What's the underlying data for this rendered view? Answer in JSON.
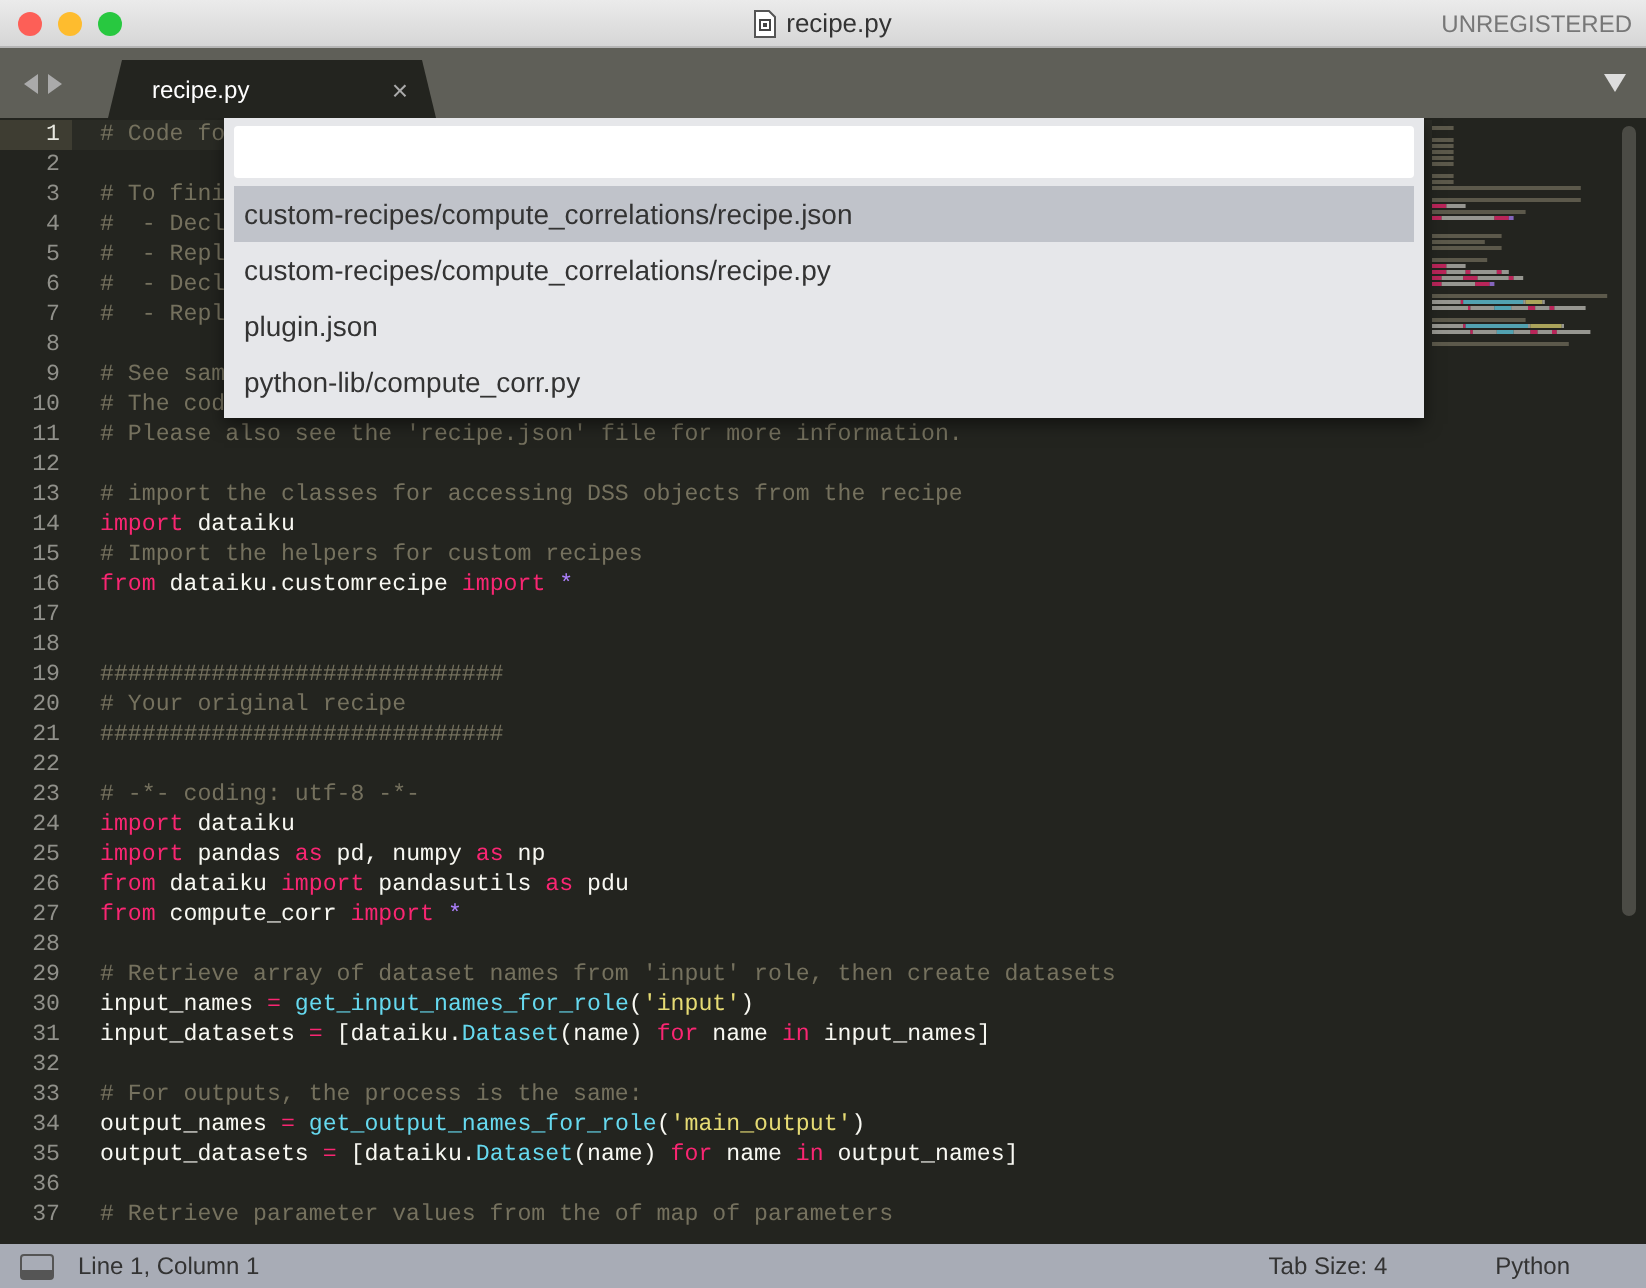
{
  "window": {
    "title": "recipe.py",
    "badge": "UNREGISTERED"
  },
  "tabs": [
    {
      "label": "recipe.py",
      "close": "×",
      "selected": true
    }
  ],
  "editor": {
    "lines": [
      {
        "number": "1",
        "current": true,
        "tokens": [
          {
            "kind": "comment",
            "text": "# Code fo"
          }
        ]
      },
      {
        "number": "2",
        "current": false
      },
      {
        "number": "3",
        "current": false,
        "tokens": [
          {
            "kind": "comment",
            "text": "# To fini"
          }
        ]
      },
      {
        "number": "4",
        "current": false,
        "tokens": [
          {
            "kind": "comment",
            "text": "#  - Decl"
          }
        ]
      },
      {
        "number": "5",
        "current": false,
        "tokens": [
          {
            "kind": "comment",
            "text": "#  - Repl"
          }
        ]
      },
      {
        "number": "6",
        "current": false,
        "tokens": [
          {
            "kind": "comment",
            "text": "#  - Decl"
          }
        ]
      },
      {
        "number": "7",
        "current": false,
        "tokens": [
          {
            "kind": "comment",
            "text": "#  - Repl"
          }
        ]
      },
      {
        "number": "8",
        "current": false
      },
      {
        "number": "9",
        "current": false,
        "tokens": [
          {
            "kind": "comment",
            "text": "# See sam"
          }
        ]
      },
      {
        "number": "10",
        "current": false,
        "tokens": [
          {
            "kind": "comment",
            "text": "# The cod"
          }
        ]
      },
      {
        "number": "11",
        "current": false,
        "tokens": [
          {
            "kind": "comment",
            "text": "# Please also see the 'recipe.json' file for more information."
          }
        ]
      },
      {
        "number": "12",
        "current": false
      },
      {
        "number": "13",
        "current": false,
        "tokens": [
          {
            "kind": "comment",
            "text": "# import the classes for accessing DSS objects from the recipe"
          }
        ]
      },
      {
        "number": "14",
        "current": false,
        "tokens": [
          {
            "kind": "keyword",
            "text": "import"
          },
          {
            "kind": "plain",
            "text": " dataiku"
          }
        ]
      },
      {
        "number": "15",
        "current": false,
        "tokens": [
          {
            "kind": "comment",
            "text": "# Import the helpers for custom recipes"
          }
        ]
      },
      {
        "number": "16",
        "current": false,
        "tokens": [
          {
            "kind": "keyword",
            "text": "from"
          },
          {
            "kind": "plain",
            "text": " dataiku.customrecipe "
          },
          {
            "kind": "keyword",
            "text": "import"
          },
          {
            "kind": "constant",
            "text": " *"
          }
        ]
      },
      {
        "number": "17",
        "current": false
      },
      {
        "number": "18",
        "current": false
      },
      {
        "number": "19",
        "current": false,
        "tokens": [
          {
            "kind": "comment",
            "text": "#############################"
          }
        ]
      },
      {
        "number": "20",
        "current": false,
        "tokens": [
          {
            "kind": "comment",
            "text": "# Your original recipe"
          }
        ]
      },
      {
        "number": "21",
        "current": false,
        "tokens": [
          {
            "kind": "comment",
            "text": "#############################"
          }
        ]
      },
      {
        "number": "22",
        "current": false
      },
      {
        "number": "23",
        "current": false,
        "tokens": [
          {
            "kind": "comment",
            "text": "# -*- coding: utf-8 -*-"
          }
        ]
      },
      {
        "number": "24",
        "current": false,
        "tokens": [
          {
            "kind": "keyword",
            "text": "import"
          },
          {
            "kind": "plain",
            "text": " dataiku"
          }
        ]
      },
      {
        "number": "25",
        "current": false,
        "tokens": [
          {
            "kind": "keyword",
            "text": "import"
          },
          {
            "kind": "plain",
            "text": " pandas "
          },
          {
            "kind": "keyword",
            "text": "as"
          },
          {
            "kind": "plain",
            "text": " pd, numpy "
          },
          {
            "kind": "keyword",
            "text": "as"
          },
          {
            "kind": "plain",
            "text": " np"
          }
        ]
      },
      {
        "number": "26",
        "current": false,
        "tokens": [
          {
            "kind": "keyword",
            "text": "from"
          },
          {
            "kind": "plain",
            "text": " dataiku "
          },
          {
            "kind": "keyword",
            "text": "import"
          },
          {
            "kind": "plain",
            "text": " pandasutils "
          },
          {
            "kind": "keyword",
            "text": "as"
          },
          {
            "kind": "plain",
            "text": " pdu"
          }
        ]
      },
      {
        "number": "27",
        "current": false,
        "tokens": [
          {
            "kind": "keyword",
            "text": "from"
          },
          {
            "kind": "plain",
            "text": " compute_corr "
          },
          {
            "kind": "keyword",
            "text": "import"
          },
          {
            "kind": "constant",
            "text": " *"
          }
        ]
      },
      {
        "number": "28",
        "current": false
      },
      {
        "number": "29",
        "current": false,
        "tokens": [
          {
            "kind": "comment",
            "text": "# Retrieve array of dataset names from 'input' role, then create datasets"
          }
        ]
      },
      {
        "number": "30",
        "current": false,
        "tokens": [
          {
            "kind": "plain",
            "text": "input_names "
          },
          {
            "kind": "keyword",
            "text": "="
          },
          {
            "kind": "function",
            "text": " get_input_names_for_role"
          },
          {
            "kind": "plain",
            "text": "("
          },
          {
            "kind": "string",
            "text": "'input'"
          },
          {
            "kind": "plain",
            "text": ")"
          }
        ]
      },
      {
        "number": "31",
        "current": false,
        "tokens": [
          {
            "kind": "plain",
            "text": "input_datasets "
          },
          {
            "kind": "keyword",
            "text": "="
          },
          {
            "kind": "plain",
            "text": " [dataiku."
          },
          {
            "kind": "function",
            "text": "Dataset"
          },
          {
            "kind": "plain",
            "text": "(name) "
          },
          {
            "kind": "keyword",
            "text": "for"
          },
          {
            "kind": "plain",
            "text": " name "
          },
          {
            "kind": "keyword",
            "text": "in"
          },
          {
            "kind": "plain",
            "text": " input_names]"
          }
        ]
      },
      {
        "number": "32",
        "current": false
      },
      {
        "number": "33",
        "current": false,
        "tokens": [
          {
            "kind": "comment",
            "text": "# For outputs, the process is the same:"
          }
        ]
      },
      {
        "number": "34",
        "current": false,
        "tokens": [
          {
            "kind": "plain",
            "text": "output_names "
          },
          {
            "kind": "keyword",
            "text": "="
          },
          {
            "kind": "function",
            "text": " get_output_names_for_role"
          },
          {
            "kind": "plain",
            "text": "("
          },
          {
            "kind": "string",
            "text": "'main_output'"
          },
          {
            "kind": "plain",
            "text": ")"
          }
        ]
      },
      {
        "number": "35",
        "current": false,
        "tokens": [
          {
            "kind": "plain",
            "text": "output_datasets "
          },
          {
            "kind": "keyword",
            "text": "="
          },
          {
            "kind": "plain",
            "text": " [dataiku."
          },
          {
            "kind": "function",
            "text": "Dataset"
          },
          {
            "kind": "plain",
            "text": "(name) "
          },
          {
            "kind": "keyword",
            "text": "for"
          },
          {
            "kind": "plain",
            "text": " name "
          },
          {
            "kind": "keyword",
            "text": "in"
          },
          {
            "kind": "plain",
            "text": " output_names]"
          }
        ]
      },
      {
        "number": "36",
        "current": false
      },
      {
        "number": "37",
        "current": false,
        "tokens": [
          {
            "kind": "comment",
            "text": "# Retrieve parameter values from the of map of parameters"
          }
        ]
      }
    ]
  },
  "goto_anything": {
    "items": [
      {
        "label": "custom-recipes/compute_correlations/recipe.json",
        "selected": true
      },
      {
        "label": "custom-recipes/compute_correlations/recipe.py",
        "selected": false
      },
      {
        "label": "plugin.json",
        "selected": false
      },
      {
        "label": "python-lib/compute_corr.py",
        "selected": false
      }
    ]
  },
  "status_bar": {
    "position": "Line 1, Column 1",
    "tab_size": "Tab Size: 4",
    "syntax": "Python"
  }
}
